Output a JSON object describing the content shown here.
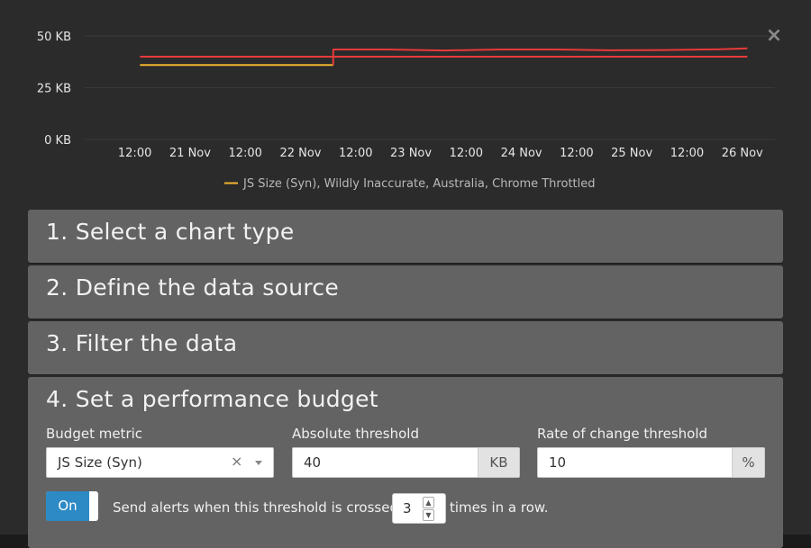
{
  "chart_data": {
    "type": "line",
    "y_ticks": [
      "50 KB",
      "25 KB",
      "0 KB"
    ],
    "x_ticks": [
      "12:00",
      "21 Nov",
      "12:00",
      "22 Nov",
      "12:00",
      "23 Nov",
      "12:00",
      "24 Nov",
      "12:00",
      "25 Nov",
      "12:00",
      "26 Nov"
    ],
    "ylim": [
      0,
      50
    ],
    "y_unit": "KB",
    "grid": true,
    "legend_position": "bottom",
    "series": [
      {
        "name": "JS Size (Syn), Wildly Inaccurate, Australia, Chrome Throttled",
        "color": "#f4b331",
        "segment": "before",
        "x": [
          "20 Nov 18:00",
          "22 Nov 12:00"
        ],
        "y": [
          36,
          36
        ]
      },
      {
        "name": "",
        "color": "#e83a3a",
        "segment": "after",
        "x": [
          "22 Nov 12:00",
          "22 Nov 12:00",
          "23 Nov 00:00",
          "23 Nov 12:00",
          "24 Nov 00:00",
          "24 Nov 12:00",
          "25 Nov 00:00",
          "25 Nov 12:00",
          "26 Nov 00:00",
          "26 Nov 06:00"
        ],
        "y": [
          36,
          43.5,
          43.5,
          43,
          43.5,
          43.5,
          43.1,
          43.2,
          43.6,
          44
        ]
      },
      {
        "name": "",
        "color": "#e83a3a",
        "kind": "threshold",
        "x": [
          "20 Nov 18:00",
          "26 Nov 06:00"
        ],
        "y": [
          40,
          40
        ]
      }
    ]
  },
  "close_icon": "×",
  "panels": [
    {
      "title": "1. Select a chart type"
    },
    {
      "title": "2. Define the data source"
    },
    {
      "title": "3. Filter the data"
    },
    {
      "title": "4. Set a performance budget"
    }
  ],
  "budget": {
    "metric_label": "Budget metric",
    "metric_value": "JS Size (Syn)",
    "clear_glyph": "×",
    "abs_label": "Absolute threshold",
    "abs_value": "40",
    "abs_unit": "KB",
    "rate_label": "Rate of change threshold",
    "rate_value": "10",
    "rate_unit": "%",
    "toggle_label": "On",
    "alert_prefix": "Send alerts when this threshold is crossed",
    "alert_count": "3",
    "alert_suffix": "times in a row.",
    "spinner_up": "▲",
    "spinner_down": "▼"
  }
}
